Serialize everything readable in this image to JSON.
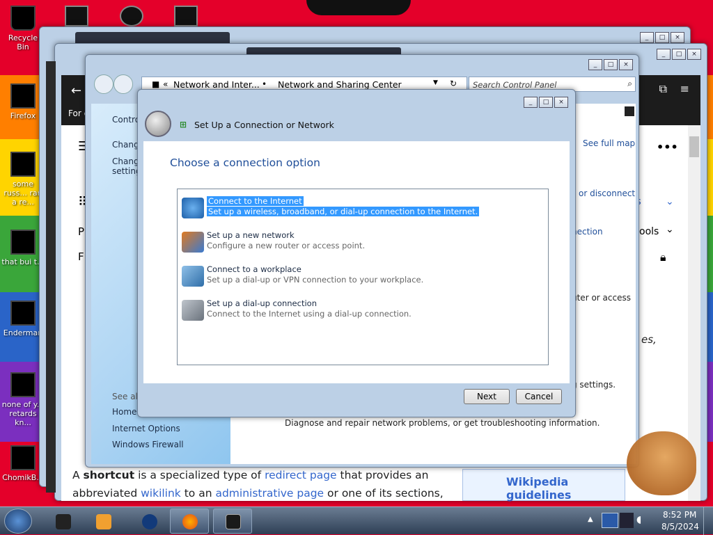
{
  "desktop": {
    "icons": [
      "Recycle Bin",
      "Firefox",
      "some russ... ran a re...",
      "that bui t...",
      "Enderman",
      "none of y... retards kn...",
      "ChomikB..."
    ]
  },
  "browser": {
    "back": "←",
    "header_snip": "For c",
    "nav_see_full_map": "See full map",
    "nav_or_disconnect": "or disconnect",
    "nav_pages": "ges",
    "nav_nection": "nection",
    "nav_tools": "ools",
    "router_text": "uter or access",
    "es_text": "es,",
    "settings_text": "g settings.",
    "diagnose": "Diagnose and repair network problems, or get troubleshooting information.",
    "article": {
      "p1_pre": "A ",
      "p1_bold": "shortcut",
      "p1_mid": " is a specialized type of ",
      "p1_link": "redirect page",
      "p1_post": " that provides an",
      "p2_pre": "abbreviated ",
      "p2_link1": "wikilink",
      "p2_mid": " to an ",
      "p2_link2": "administrative page",
      "p2_post": " or one of its sections, usually"
    },
    "guideline": "Wikipedia guidelines",
    "letter_p": "P",
    "letter_f": "F"
  },
  "explorer": {
    "breadcrumb_1": "Network and Inter...",
    "breadcrumb_2": "Network and Sharing Center",
    "search_placeholder": "Search Control Panel",
    "sidebar": {
      "top": "Contro",
      "item1": "Change",
      "item2a": "Change",
      "item2b": "setting",
      "see_also": "See also",
      "home": "HomeG",
      "internet_options": "Internet Options",
      "firewall": "Windows Firewall"
    }
  },
  "dialog": {
    "title": "Set Up a Connection or Network",
    "heading": "Choose a connection option",
    "options": [
      {
        "title": "Connect to the Internet",
        "desc": "Set up a wireless, broadband, or dial-up connection to the Internet.",
        "icon": "globe-icon"
      },
      {
        "title": "Set up a new network",
        "desc": "Configure a new router or access point.",
        "icon": "router-icon"
      },
      {
        "title": "Connect to a workplace",
        "desc": "Set up a dial-up or VPN connection to your workplace.",
        "icon": "workplace-icon"
      },
      {
        "title": "Set up a dial-up connection",
        "desc": "Connect to the Internet using a dial-up connection.",
        "icon": "phone-icon"
      }
    ],
    "next": "Next",
    "cancel": "Cancel"
  },
  "tray": {
    "time": "8:52 PM",
    "date": "8/5/2024"
  },
  "colors": {
    "accent": "#3399ff",
    "link": "#3366cc",
    "title": "#1f4e99"
  }
}
